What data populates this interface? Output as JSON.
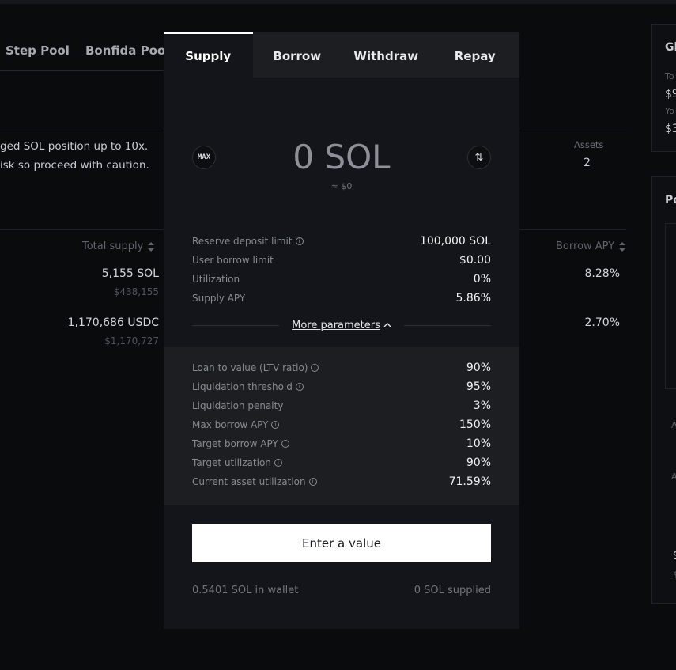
{
  "background": {
    "pool_tabs": [
      "Step Pool",
      "Bonfida Pool"
    ],
    "info_lines": [
      "ged SOL position up to 10x.",
      "isk so proceed with caution."
    ],
    "assets": {
      "label": "Assets",
      "value": "2"
    },
    "columns": {
      "total_supply": "Total supply",
      "borrow_apy": "Borrow APY"
    },
    "rows": [
      {
        "supply": "5,155 SOL",
        "supply_usd": "$438,155",
        "borrow_apy": "8.28%"
      },
      {
        "supply": "1,170,686 USDC",
        "supply_usd": "$1,170,727",
        "borrow_apy": "2.70%"
      }
    ],
    "side": {
      "title_1": "Gl",
      "small_1": "To",
      "value_1": "$9",
      "small_2": "Yo",
      "value_2": "$3",
      "title_2": "Po",
      "a1": "A",
      "a2": "A",
      "s": "S",
      "dollar": "$"
    }
  },
  "modal": {
    "tabs": [
      "Supply",
      "Borrow",
      "Withdraw",
      "Repay"
    ],
    "active_tab": "Supply",
    "max_label": "MAX",
    "swap_icon": "⇅",
    "amount": "0 SOL",
    "amount_usd": "≈ $0",
    "params": [
      {
        "label": "Reserve deposit limit",
        "value": "100,000 SOL",
        "info": true
      },
      {
        "label": "User borrow limit",
        "value": "$0.00",
        "info": false
      },
      {
        "label": "Utilization",
        "value": "0%",
        "info": false
      },
      {
        "label": "Supply APY",
        "value": "5.86%",
        "info": false
      }
    ],
    "more_parameters": "More parameters",
    "more_params": [
      {
        "label": "Loan to value (LTV ratio)",
        "value": "90%",
        "info": true
      },
      {
        "label": "Liquidation threshold",
        "value": "95%",
        "info": true
      },
      {
        "label": "Liquidation penalty",
        "value": "3%",
        "info": false
      },
      {
        "label": "Max borrow APY",
        "value": "150%",
        "info": true
      },
      {
        "label": "Target borrow APY",
        "value": "10%",
        "info": true
      },
      {
        "label": "Target utilization",
        "value": "90%",
        "info": true
      },
      {
        "label": "Current asset utilization",
        "value": "71.59%",
        "info": true
      }
    ],
    "submit_label": "Enter a value",
    "wallet_balance": "0.5401 SOL in wallet",
    "supplied": "0 SOL supplied"
  }
}
